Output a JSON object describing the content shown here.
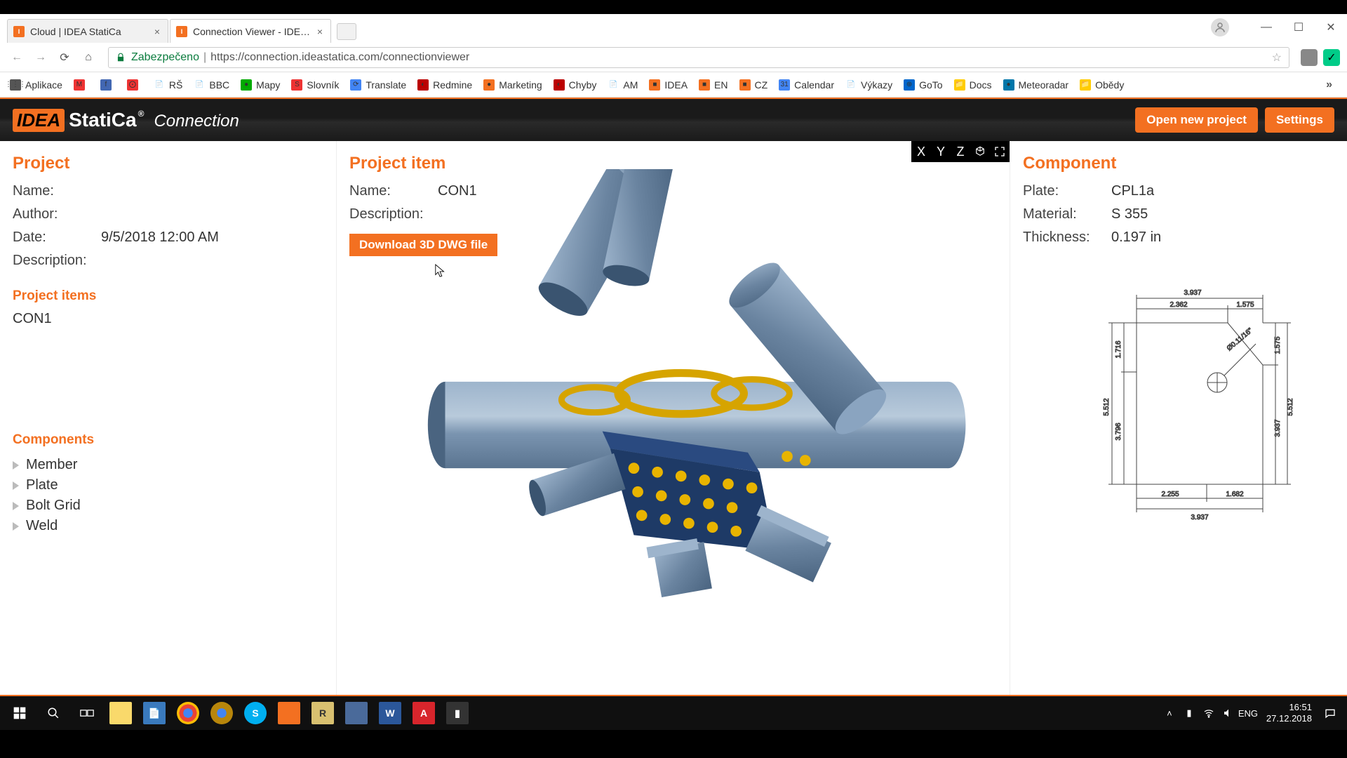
{
  "browser": {
    "tabs": [
      {
        "label": "Cloud | IDEA StatiCa"
      },
      {
        "label": "Connection Viewer - IDE…"
      }
    ],
    "secure_label": "Zabezpečeno",
    "url": "https://connection.ideastatica.com/connectionviewer",
    "bookmarks": [
      {
        "label": "Aplikace",
        "bg": "#555",
        "glyph": "⋮⋮⋮"
      },
      {
        "label": "",
        "bg": "#e33",
        "glyph": "M"
      },
      {
        "label": "",
        "bg": "#4267B2",
        "glyph": "f"
      },
      {
        "label": "",
        "bg": "#e33",
        "glyph": "⨀"
      },
      {
        "label": "RŠ",
        "bg": "#fff",
        "glyph": "📄"
      },
      {
        "label": "BBC",
        "bg": "#fff",
        "glyph": "📄"
      },
      {
        "label": "Mapy",
        "bg": "#0a0",
        "glyph": "●"
      },
      {
        "label": "Slovník",
        "bg": "#e33",
        "glyph": "S"
      },
      {
        "label": "Translate",
        "bg": "#4285F4",
        "glyph": "⟳"
      },
      {
        "label": "Redmine",
        "bg": "#b00",
        "glyph": "◐"
      },
      {
        "label": "Marketing",
        "bg": "#f37021",
        "glyph": "●"
      },
      {
        "label": "Chyby",
        "bg": "#b00",
        "glyph": "◐"
      },
      {
        "label": "AM",
        "bg": "#fff",
        "glyph": "📄"
      },
      {
        "label": "IDEA",
        "bg": "#f37021",
        "glyph": "■"
      },
      {
        "label": "EN",
        "bg": "#f37021",
        "glyph": "■"
      },
      {
        "label": "CZ",
        "bg": "#f37021",
        "glyph": "■"
      },
      {
        "label": "Calendar",
        "bg": "#4285F4",
        "glyph": "31"
      },
      {
        "label": "Výkazy",
        "bg": "#fff",
        "glyph": "📄"
      },
      {
        "label": "GoTo",
        "bg": "#06c",
        "glyph": "⊕"
      },
      {
        "label": "Docs",
        "bg": "#fc0",
        "glyph": "📁"
      },
      {
        "label": "Meteoradar",
        "bg": "#07a",
        "glyph": "●"
      },
      {
        "label": "Obědy",
        "bg": "#fc0",
        "glyph": "📁"
      }
    ]
  },
  "header": {
    "logo_connection": "Connection",
    "open_project": "Open new project",
    "settings": "Settings"
  },
  "project": {
    "title": "Project",
    "name_label": "Name:",
    "name_value": "",
    "author_label": "Author:",
    "author_value": "",
    "date_label": "Date:",
    "date_value": "9/5/2018 12:00 AM",
    "desc_label": "Description:",
    "desc_value": "",
    "items_title": "Project items",
    "item1": "CON1",
    "components_title": "Components",
    "components": [
      "Member",
      "Plate",
      "Bolt Grid",
      "Weld"
    ]
  },
  "project_item": {
    "title": "Project item",
    "name_label": "Name:",
    "name_value": "CON1",
    "desc_label": "Description:",
    "desc_value": "",
    "download": "Download 3D DWG file",
    "vp_buttons": [
      "X",
      "Y",
      "Z"
    ]
  },
  "component": {
    "title": "Component",
    "plate_label": "Plate:",
    "plate_value": "CPL1a",
    "material_label": "Material:",
    "material_value": "S 355",
    "thickness_label": "Thickness:",
    "thickness_value": "0.197 in",
    "dims": {
      "top_total": "3.937",
      "top_left": "2.362",
      "top_right": "1.575",
      "left_total": "5.512",
      "left_upper": "1.716",
      "left_lower": "3.796",
      "right_total": "5.512",
      "right_upper": "1.575",
      "right_lower": "3.937",
      "bottom_total": "3.937",
      "bottom_left": "2.255",
      "bottom_right": "1.682",
      "hole": "Ø0.11/16\""
    }
  },
  "taskbar": {
    "time": "16:51",
    "date": "27.12.2018",
    "lang": "ENG"
  }
}
